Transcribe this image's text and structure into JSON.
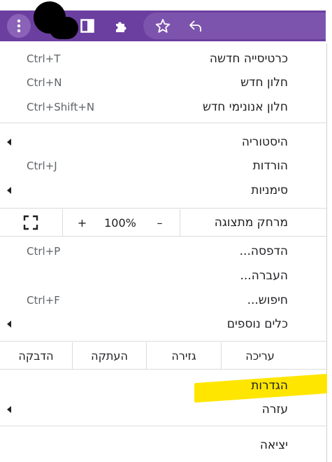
{
  "menu": {
    "section1": [
      {
        "label": "כרטיסייה חדשה",
        "shortcut": "Ctrl+T"
      },
      {
        "label": "חלון חדש",
        "shortcut": "Ctrl+N"
      },
      {
        "label": "חלון אנונימי חדש",
        "shortcut": "Ctrl+Shift+N"
      }
    ],
    "section2": [
      {
        "label": "היסטוריה",
        "shortcut": ""
      },
      {
        "label": "הורדות",
        "shortcut": "Ctrl+J"
      },
      {
        "label": "סימניות",
        "shortcut": ""
      }
    ],
    "zoom": {
      "label": "מרחק מתצוגה",
      "minus": "–",
      "value": "100%",
      "plus": "+"
    },
    "section3": [
      {
        "label": "הדפסה...",
        "shortcut": "Ctrl+P"
      },
      {
        "label": "העברה...",
        "shortcut": ""
      },
      {
        "label": "חיפוש...",
        "shortcut": "Ctrl+F"
      },
      {
        "label": "כלים נוספים",
        "shortcut": ""
      }
    ],
    "edit": {
      "label": "עריכה",
      "cut": "גזירה",
      "copy": "העתקה",
      "paste": "הדבקה"
    },
    "section4": [
      {
        "label": "הגדרות",
        "shortcut": ""
      },
      {
        "label": "עזרה",
        "shortcut": ""
      }
    ],
    "exit": {
      "label": "יציאה"
    }
  },
  "colors": {
    "toolbar": "#6b3fa0",
    "highlight": "#ffe600"
  },
  "icons": [
    "kebab-menu-icon",
    "sidebar-icon",
    "puzzle-extensions-icon",
    "star-bookmark-icon",
    "share-icon",
    "fullscreen-icon"
  ]
}
